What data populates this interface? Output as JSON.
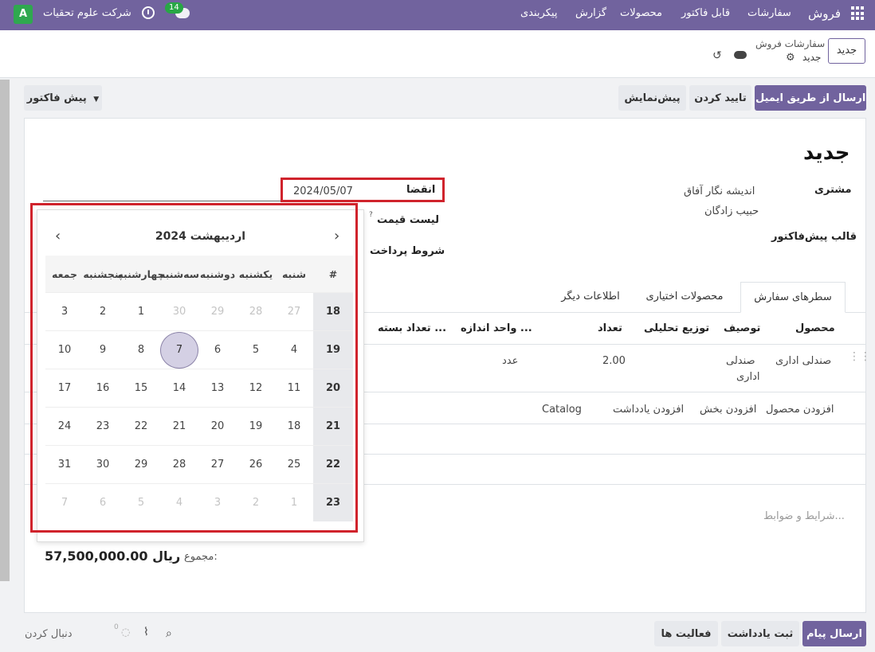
{
  "navbar": {
    "brand": "فروش",
    "menu": [
      "سفارشات",
      "قابل فاکتور",
      "محصولات",
      "گزارش",
      "پیکربندی"
    ],
    "company": "شرکت علوم تحقیات",
    "avatar_letter": "A",
    "chat_count": "14"
  },
  "control_panel": {
    "new_button": "جدید",
    "breadcrumb_parent": "سفارشات فروش",
    "breadcrumb_current": "جدید"
  },
  "actions": {
    "send_email": "ارسال از طریق ایمیل",
    "confirm": "تایید کردن",
    "preview": "پیش‌نمایش",
    "status": "پیش فاکتور"
  },
  "form": {
    "title": "جدید",
    "customer_label": "مشتری",
    "customer_line1": "اندیشه نگار آفاق",
    "customer_line2": "حبیب زادگان",
    "quote_template_label": "قالب پیش‌فاکتور",
    "expiration_label": "انقضا",
    "expiration_value": "2024/05/07",
    "pricelist_label": "لیست قیمت",
    "pricelist_help": "?",
    "payment_terms_label": "شروط پرداخت"
  },
  "tabs": [
    "سطرهای سفارش",
    "محصولات اختیاری",
    "اطلاعات دیگر"
  ],
  "order_table": {
    "headers": [
      "محصول",
      "توصیف",
      "توزیع تحلیلی",
      "تعداد",
      "واحد اندازه ...",
      "تعداد بسته ..."
    ],
    "row": {
      "product": "صندلی اداری",
      "description_line1": "صندلی",
      "description_line2": "اداری",
      "quantity": "2.00",
      "uom": "عدد"
    },
    "add_links": [
      "افزودن محصول",
      "افزودن بخش",
      "افزودن یادداشت",
      "Catalog"
    ]
  },
  "terms_placeholder": "شرایط و ضوابط...",
  "totals": {
    "label": "مجموع:",
    "amount": "57,500,000.00",
    "currency": "ریال"
  },
  "chatter": {
    "send_message": "ارسال پیام",
    "log_note": "ثبت یادداشت",
    "activities": "فعالیت ها",
    "follow": "دنبال کردن",
    "followers_count": "0"
  },
  "datepicker": {
    "month_label": "اردیبهشت 2024",
    "week_header": "#",
    "days": [
      "شنبه",
      "یکشنبه",
      "دوشنبه",
      "سه‌شنبه",
      "چهارشنبه",
      "پنجشنبه",
      "جمعه"
    ],
    "weeks": [
      {
        "week": "18",
        "days": [
          {
            "d": "27",
            "off": true
          },
          {
            "d": "28",
            "off": true
          },
          {
            "d": "29",
            "off": true
          },
          {
            "d": "30",
            "off": true
          },
          {
            "d": "1"
          },
          {
            "d": "2"
          },
          {
            "d": "3"
          }
        ]
      },
      {
        "week": "19",
        "days": [
          {
            "d": "4"
          },
          {
            "d": "5"
          },
          {
            "d": "6"
          },
          {
            "d": "7",
            "sel": true
          },
          {
            "d": "8"
          },
          {
            "d": "9"
          },
          {
            "d": "10"
          }
        ]
      },
      {
        "week": "20",
        "days": [
          {
            "d": "11"
          },
          {
            "d": "12"
          },
          {
            "d": "13"
          },
          {
            "d": "14"
          },
          {
            "d": "15"
          },
          {
            "d": "16"
          },
          {
            "d": "17"
          }
        ]
      },
      {
        "week": "21",
        "days": [
          {
            "d": "18"
          },
          {
            "d": "19"
          },
          {
            "d": "20"
          },
          {
            "d": "21"
          },
          {
            "d": "22"
          },
          {
            "d": "23"
          },
          {
            "d": "24"
          }
        ]
      },
      {
        "week": "22",
        "days": [
          {
            "d": "25"
          },
          {
            "d": "26"
          },
          {
            "d": "27"
          },
          {
            "d": "28"
          },
          {
            "d": "29"
          },
          {
            "d": "30"
          },
          {
            "d": "31"
          }
        ]
      },
      {
        "week": "23",
        "days": [
          {
            "d": "1",
            "off": true
          },
          {
            "d": "2",
            "off": true
          },
          {
            "d": "3",
            "off": true
          },
          {
            "d": "4",
            "off": true
          },
          {
            "d": "5",
            "off": true
          },
          {
            "d": "6",
            "off": true
          },
          {
            "d": "7",
            "off": true
          }
        ]
      }
    ]
  },
  "colors": {
    "brand": "#71639e",
    "highlight": "#d0232c"
  }
}
